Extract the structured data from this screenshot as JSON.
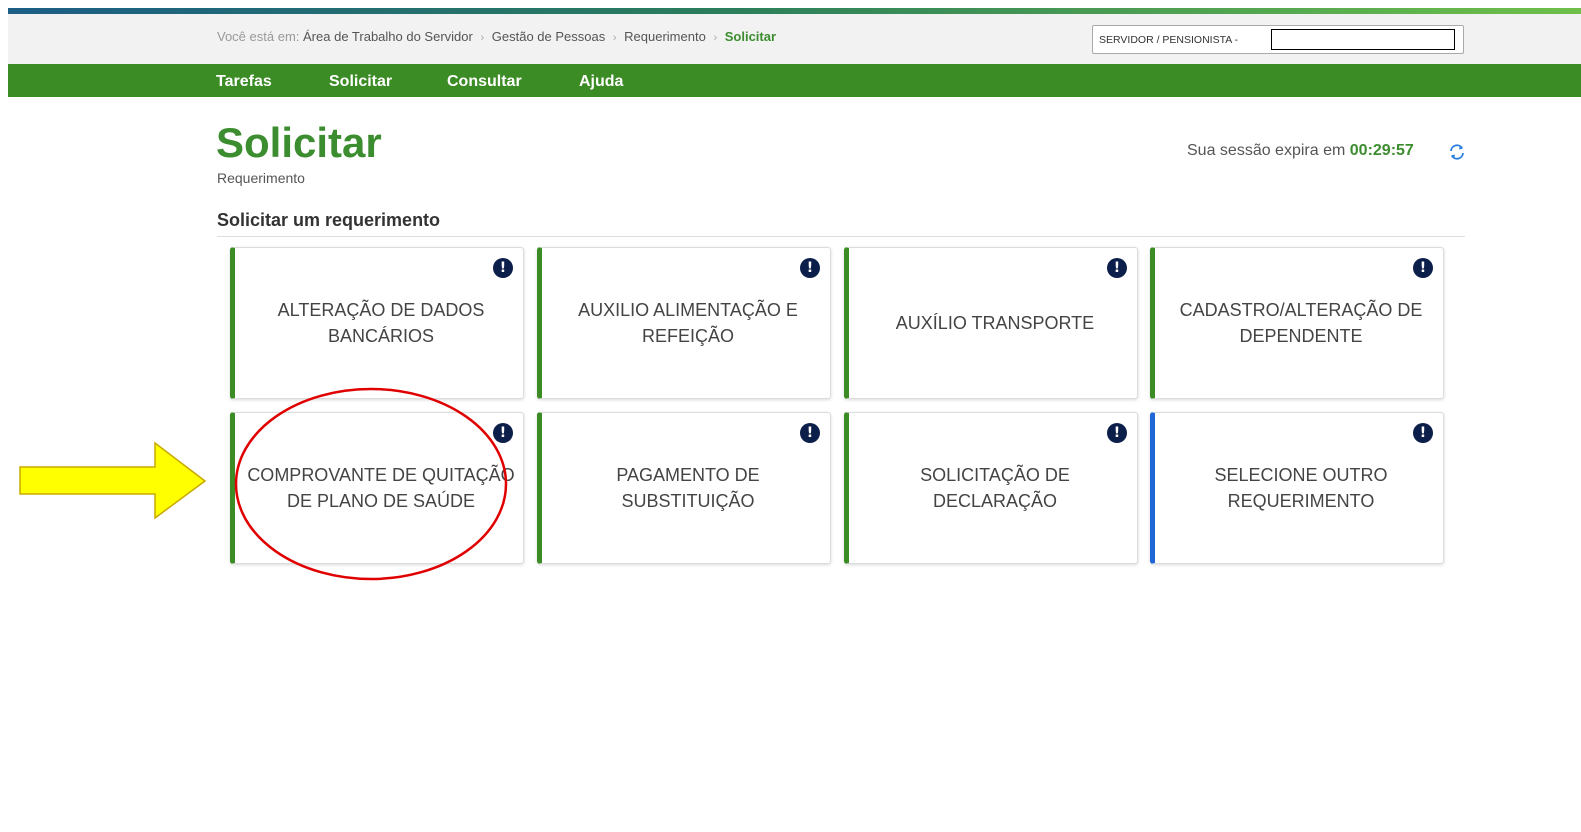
{
  "breadcrumb": {
    "prefix": "Você está em:",
    "items": [
      "Área de Trabalho do Servidor",
      "Gestão de Pessoas",
      "Requerimento"
    ],
    "current": "Solicitar"
  },
  "user_box": {
    "label": "SERVIDOR / PENSIONISTA -",
    "value": ""
  },
  "nav": {
    "items": [
      "Tarefas",
      "Solicitar",
      "Consultar",
      "Ajuda"
    ]
  },
  "page": {
    "title": "Solicitar",
    "subtitle": "Requerimento"
  },
  "session": {
    "label": "Sua sessão expira em",
    "time": "00:29:57"
  },
  "section": {
    "title": "Solicitar um requerimento"
  },
  "cards": [
    {
      "label": "ALTERAÇÃO DE DADOS BANCÁRIOS",
      "info_icon": "!"
    },
    {
      "label": "AUXILIO ALIMENTAÇÃO E REFEIÇÃO",
      "info_icon": "!"
    },
    {
      "label": "AUXÍLIO TRANSPORTE",
      "info_icon": "!"
    },
    {
      "label": "CADASTRO/ALTERAÇÃO DE DEPENDENTE",
      "info_icon": "!"
    },
    {
      "label": "COMPROVANTE DE QUITAÇÃO DE PLANO DE SAÚDE",
      "info_icon": "!"
    },
    {
      "label": "PAGAMENTO DE SUBSTITUIÇÃO",
      "info_icon": "!"
    },
    {
      "label": "SOLICITAÇÃO DE DECLARAÇÃO",
      "info_icon": "!"
    },
    {
      "label": "SELECIONE OUTRO REQUERIMENTO",
      "info_icon": "!"
    }
  ],
  "colors": {
    "primary_green": "#3c8c25",
    "title_green": "#3c8d2f",
    "card_accent_other": "#1f66d6",
    "info_icon_bg": "#0c1f4a",
    "annotation_arrow": "#ffff00",
    "annotation_circle": "#e00000"
  },
  "annotations": {
    "arrow": "yellow-arrow-pointing-right",
    "circle": "red-ellipse-highlight"
  }
}
